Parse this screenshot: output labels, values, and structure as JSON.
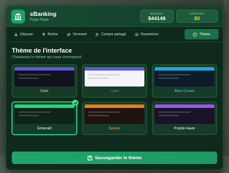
{
  "app": {
    "title": "sBanking",
    "user": "Pepe Pepe",
    "logo_icon": "bank-icon"
  },
  "balances": [
    {
      "label": "BANQUE",
      "value": "$44149",
      "color": "#ffffff"
    },
    {
      "label": "ESPÈCES",
      "value": "$0",
      "color": "#f5c542"
    }
  ],
  "tabs": [
    {
      "label": "Déposer",
      "icon": "arrow-down-icon"
    },
    {
      "label": "Retirer",
      "icon": "arrow-up-icon"
    },
    {
      "label": "Virement",
      "icon": "transfer-icon"
    },
    {
      "label": "Compte partagé",
      "icon": "users-icon"
    },
    {
      "label": "Paramètres",
      "icon": "gear-icon"
    },
    {
      "label": "Thème",
      "icon": "palette-icon",
      "active": true
    }
  ],
  "theme_section": {
    "title": "Thème de l'interface",
    "subtitle": "Choisissez le thème qui vous correspond"
  },
  "themes": [
    {
      "name": "Dark",
      "accent": "#5b5bd6",
      "bg": "#10131c",
      "label_color": "#c9d6cc",
      "selected": false
    },
    {
      "name": "Light",
      "accent": "#5b5bd6",
      "bg": "#f4f5f8",
      "label_color": "#6c8476",
      "selected": false
    },
    {
      "name": "Blue Ocean",
      "accent": "#1aa7e0",
      "bg": "#0d1a2a",
      "label_color": "#56c2f0",
      "selected": false
    },
    {
      "name": "Emerald",
      "accent": "#2bd37f",
      "bg": "#0d2418",
      "label_color": "#ffffff",
      "selected": true
    },
    {
      "name": "Sunset",
      "accent": "#f07a1a",
      "bg": "#1f140c",
      "label_color": "#f0a050",
      "selected": false
    },
    {
      "name": "Purple Haze",
      "accent": "#a64ff0",
      "bg": "#1a1226",
      "label_color": "#ffffff",
      "selected": false
    }
  ],
  "save_button": {
    "label": "Sauvegarder le thème",
    "icon": "save-icon"
  }
}
